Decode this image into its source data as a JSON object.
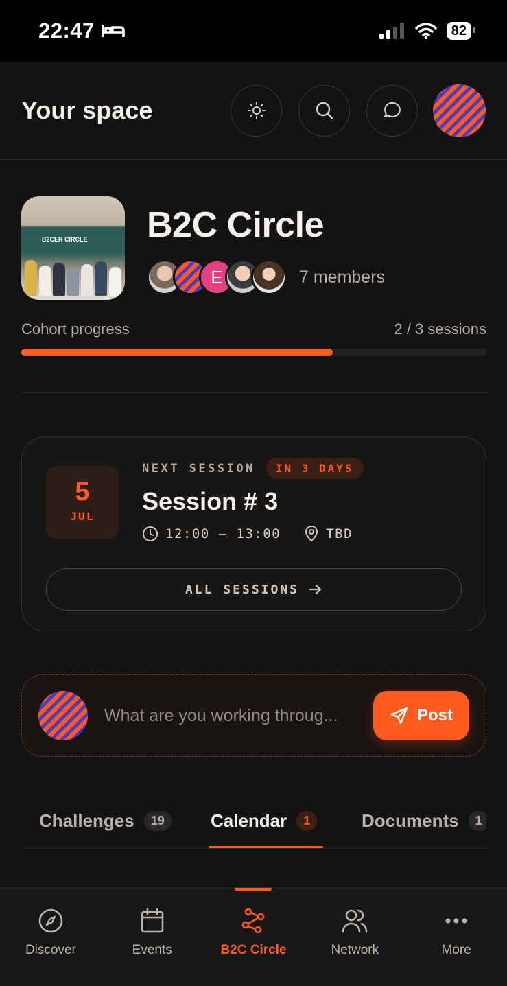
{
  "status_bar": {
    "time": "22:47",
    "battery": "82"
  },
  "header": {
    "title": "Your space"
  },
  "group": {
    "name": "B2C Circle",
    "photo_sign": "B2CER CIRCLE",
    "member_initial": "E",
    "members_label": "7 members"
  },
  "progress": {
    "label": "Cohort progress",
    "value_text": "2 / 3 sessions",
    "fraction": 0.67
  },
  "next_session": {
    "day": "5",
    "month": "JUL",
    "kicker": "NEXT SESSION",
    "badge": "IN 3 DAYS",
    "title": "Session # 3",
    "time": "12:00 – 13:00",
    "location": "TBD",
    "all_sessions_label": "ALL SESSIONS"
  },
  "composer": {
    "placeholder": "What are you working throug...",
    "post_label": "Post"
  },
  "tabs": [
    {
      "label": "Challenges",
      "count": "19"
    },
    {
      "label": "Calendar",
      "count": "1"
    },
    {
      "label": "Documents",
      "count": "1"
    }
  ],
  "nav": [
    {
      "label": "Discover",
      "icon": "compass-icon"
    },
    {
      "label": "Events",
      "icon": "calendar-icon"
    },
    {
      "label": "B2C Circle",
      "icon": "circle-network-icon"
    },
    {
      "label": "Network",
      "icon": "people-icon"
    },
    {
      "label": "More",
      "icon": "more-icon"
    }
  ],
  "colors": {
    "accent": "#ff5a1f",
    "background": "#141313"
  }
}
